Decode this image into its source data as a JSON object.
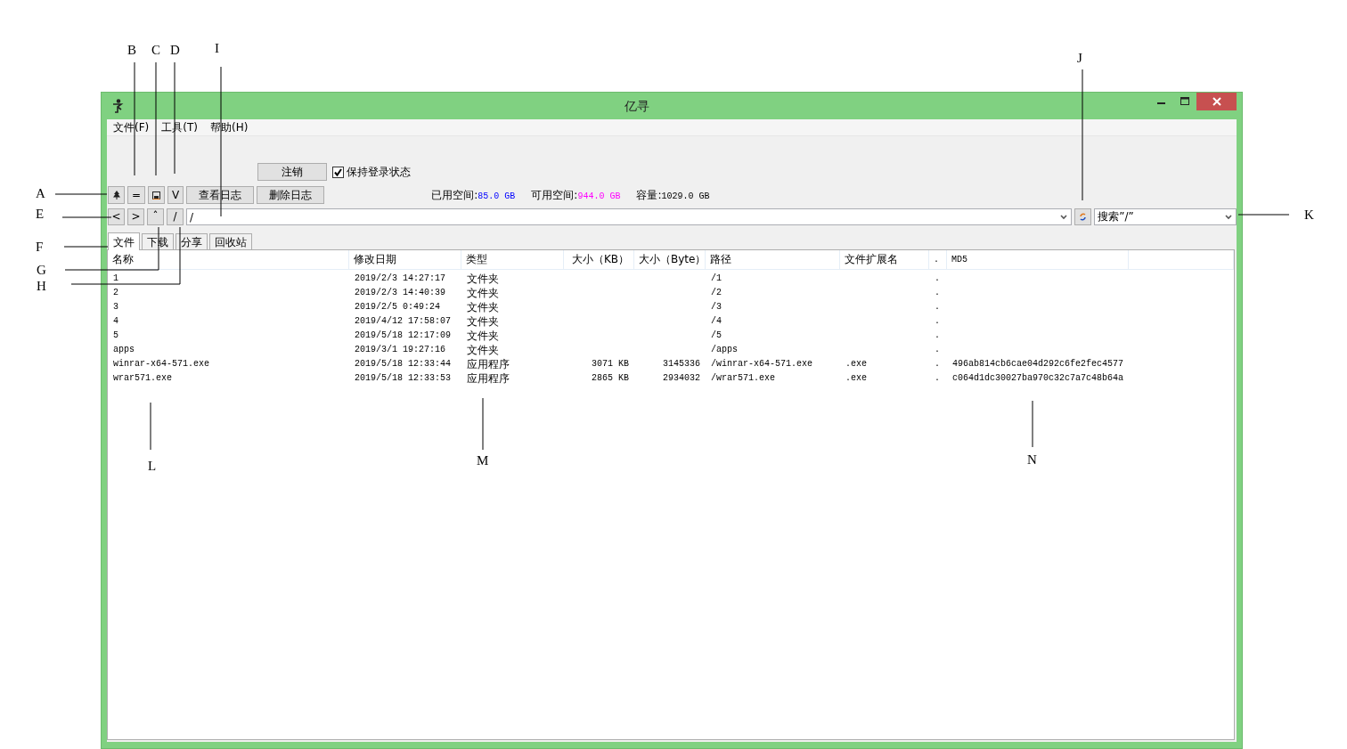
{
  "window": {
    "title": "亿寻"
  },
  "menu": [
    "文件(F)",
    "工具(T)",
    "帮助(H)"
  ],
  "logout_button": "注销",
  "keep_login": {
    "label": "保持登录状态",
    "checked": true
  },
  "tool_buttons": [
    {
      "kind": "tree"
    },
    {
      "kind": "text",
      "text": "="
    },
    {
      "kind": "save"
    },
    {
      "kind": "text",
      "text": "V"
    },
    {
      "kind": "text",
      "text": "查看日志"
    },
    {
      "kind": "text",
      "text": "删除日志"
    }
  ],
  "storage": [
    {
      "label": "已用空间:",
      "value": "85.0 GB",
      "color": "#0000ff"
    },
    {
      "label": "可用空间:",
      "value": "944.0 GB",
      "color": "#ff00ff"
    },
    {
      "label": "容量:",
      "value": "1029.0 GB",
      "color": "#000000"
    }
  ],
  "nav_buttons": [
    "<",
    ">",
    "ˆ",
    "/"
  ],
  "path_field": {
    "value": "/"
  },
  "search_field": {
    "value": "搜索”/”"
  },
  "tabs": [
    {
      "label": "文件",
      "selected": true
    },
    {
      "label": "下载",
      "selected": false
    },
    {
      "label": "分享",
      "selected": false
    },
    {
      "label": "回收站",
      "selected": false
    }
  ],
  "table": {
    "columns": [
      "名称",
      "修改日期",
      "类型",
      "大小（KB）",
      "大小（Byte）",
      "路径",
      "文件扩展名",
      ".",
      "MD5"
    ],
    "rows": [
      {
        "name": "1",
        "modified": "2019/2/3 14:27:17",
        "type": "文件夹",
        "path": "/1",
        "column_8": "."
      },
      {
        "name": "2",
        "modified": "2019/2/3 14:40:39",
        "type": "文件夹",
        "path": "/2",
        "column_8": "."
      },
      {
        "name": "3",
        "modified": "2019/2/5 0:49:24",
        "type": "文件夹",
        "path": "/3",
        "column_8": "."
      },
      {
        "name": "4",
        "modified": "2019/4/12 17:58:07",
        "type": "文件夹",
        "path": "/4",
        "column_8": "."
      },
      {
        "name": "5",
        "modified": "2019/5/18 12:17:09",
        "type": "文件夹",
        "path": "/5",
        "column_8": "."
      },
      {
        "name": "apps",
        "modified": "2019/3/1 19:27:16",
        "type": "文件夹",
        "path": "/apps",
        "column_8": "."
      },
      {
        "name": "winrar-x64-571.exe",
        "modified": "2019/5/18 12:33:44",
        "type": "应用程序",
        "size_kb": "3071 KB",
        "size_bytes": "3145336",
        "path": "/winrar-x64-571.exe",
        "extension": ".exe",
        "column_8": ".",
        "md5": "496ab814cb6cae04d292c6fe2fec4577"
      },
      {
        "name": "wrar571.exe",
        "modified": "2019/5/18 12:33:53",
        "type": "应用程序",
        "size_kb": "2865 KB",
        "size_bytes": "2934032",
        "path": "/wrar571.exe",
        "extension": ".exe",
        "column_8": ".",
        "md5": "c064d1dc30027ba970c32c7a7c48b64a"
      }
    ]
  },
  "callouts": [
    "B",
    "C",
    "D",
    "I",
    "J",
    "A",
    "E",
    "K",
    "F",
    "G",
    "H",
    "L",
    "M",
    "N"
  ]
}
